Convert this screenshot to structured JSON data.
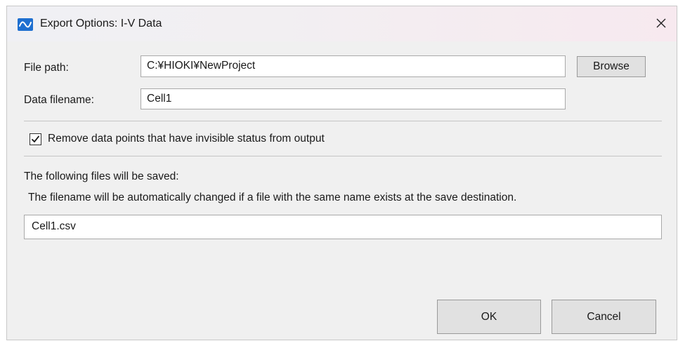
{
  "window": {
    "title": "Export Options: I-V Data",
    "icon": "waveform-icon",
    "close_glyph": "✕"
  },
  "form": {
    "file_path_label": "File path:",
    "file_path_value": "C:¥HIOKI¥NewProject",
    "browse_label": "Browse",
    "data_filename_label": "Data filename:",
    "data_filename_value": "Cell1",
    "remove_invisible_label": "Remove data points that have invisible status from output",
    "remove_invisible_checked": true
  },
  "output": {
    "heading": "The following files will be saved:",
    "note": "The filename will be automatically changed if a file with the same name exists at the save destination.",
    "files": [
      "Cell1.csv"
    ]
  },
  "actions": {
    "ok_label": "OK",
    "cancel_label": "Cancel"
  },
  "colors": {
    "icon_blue": "#1e6fd0",
    "dialog_bg": "#f0f0f0"
  }
}
